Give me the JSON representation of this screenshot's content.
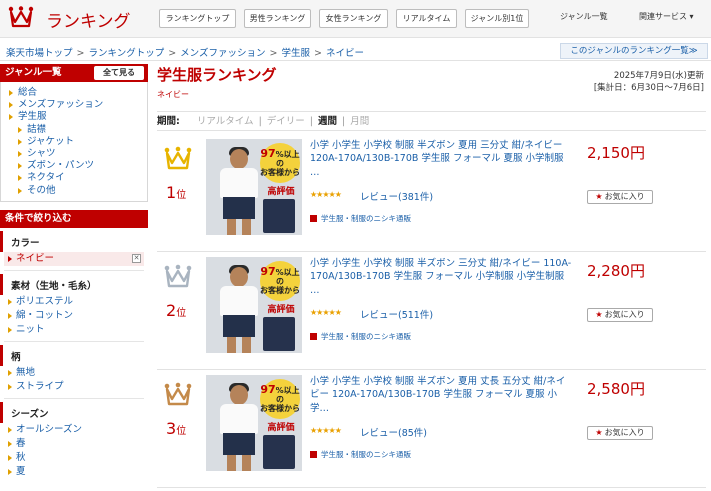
{
  "header": {
    "brand": "ランキング",
    "nav": [
      "ランキングトップ",
      "男性ランキング",
      "女性ランキング",
      "リアルタイム",
      "ジャンル別1位"
    ],
    "links": [
      "ジャンル一覧",
      "関連サービス ▾"
    ]
  },
  "breadcrumb": [
    "楽天市場トップ",
    "ランキングトップ",
    "メンズファッション",
    "学生服",
    "ネイビー"
  ],
  "genre_ranking_link": "このジャンルのランキング一覧≫",
  "sidebar": {
    "genre_head": "ジャンル一覧",
    "show_all": "全て見る",
    "genres": [
      {
        "label": "総合",
        "sub": false
      },
      {
        "label": "メンズファッション",
        "sub": false
      },
      {
        "label": "学生服",
        "sub": false
      },
      {
        "label": "詰襟",
        "sub": true
      },
      {
        "label": "ジャケット",
        "sub": true
      },
      {
        "label": "シャツ",
        "sub": true
      },
      {
        "label": "ズボン・パンツ",
        "sub": true
      },
      {
        "label": "ネクタイ",
        "sub": true
      },
      {
        "label": "その他",
        "sub": true
      }
    ],
    "filter_head": "条件で絞り込む",
    "filters": [
      {
        "title": "カラー",
        "items": [
          "ネイビー"
        ],
        "selected": 0
      },
      {
        "title": "素材（生地・毛糸）",
        "items": [
          "ポリエステル",
          "綿・コットン",
          "ニット"
        ],
        "selected": -1
      },
      {
        "title": "柄",
        "items": [
          "無地",
          "ストライプ"
        ],
        "selected": -1
      },
      {
        "title": "シーズン",
        "items": [
          "オールシーズン",
          "春",
          "秋",
          "夏"
        ],
        "selected": -1
      }
    ],
    "remove_mark": "✕"
  },
  "main": {
    "title": "学生服ランキング",
    "subgenre": "ネイビー",
    "updated": "2025年7月9日(水)更新",
    "period_range": "[集計日：6月30日〜7月6日]",
    "period_label": "期間:",
    "period_options": [
      {
        "label": "リアルタイム",
        "active": false
      },
      {
        "label": "デイリー",
        "active": false
      },
      {
        "label": "週間",
        "active": true
      },
      {
        "label": "月間",
        "active": false
      }
    ],
    "rank_suffix": "位",
    "fav_label": "お気に入り",
    "img_badge": {
      "num": "97",
      "line1": "%以上の",
      "line2": "お客様から",
      "line3": "高評価"
    }
  },
  "items": [
    {
      "rank": "1",
      "crown_color": "#e7b400",
      "title": "小学 小学生 小学校 制服 半ズボン 夏用 三分丈 紺/ネイビー 120A-170A/130B-170B 学生服 フォーマル 夏服 小学制服 …",
      "stars": "★★★★★",
      "review": "レビュー(381件)",
      "shop": "学生服・制服のニシキ通販",
      "price": "2,150円"
    },
    {
      "rank": "2",
      "crown_color": "#a9b4c0",
      "title": "小学 小学生 小学校 制服 半ズボン 三分丈 紺/ネイビー 110A-170A/130B-170B 学生服 フォーマル 小学制服 小学生制服 …",
      "stars": "★★★★★",
      "review": "レビュー(511件)",
      "shop": "学生服・制服のニシキ通販",
      "price": "2,280円"
    },
    {
      "rank": "3",
      "crown_color": "#c48a4a",
      "title": "小学 小学生 小学校 制服 半ズボン 夏用 丈長 五分丈 紺/ネイビー 120A-170A/130B-170B 学生服 フォーマル 夏服 小学…",
      "stars": "★★★★★",
      "review": "レビュー(85件)",
      "shop": "学生服・制服のニシキ通販",
      "price": "2,580円"
    }
  ],
  "colors": {
    "accent": "#bf0000",
    "link": "#1a5fa8",
    "tri": "#e0a000"
  }
}
